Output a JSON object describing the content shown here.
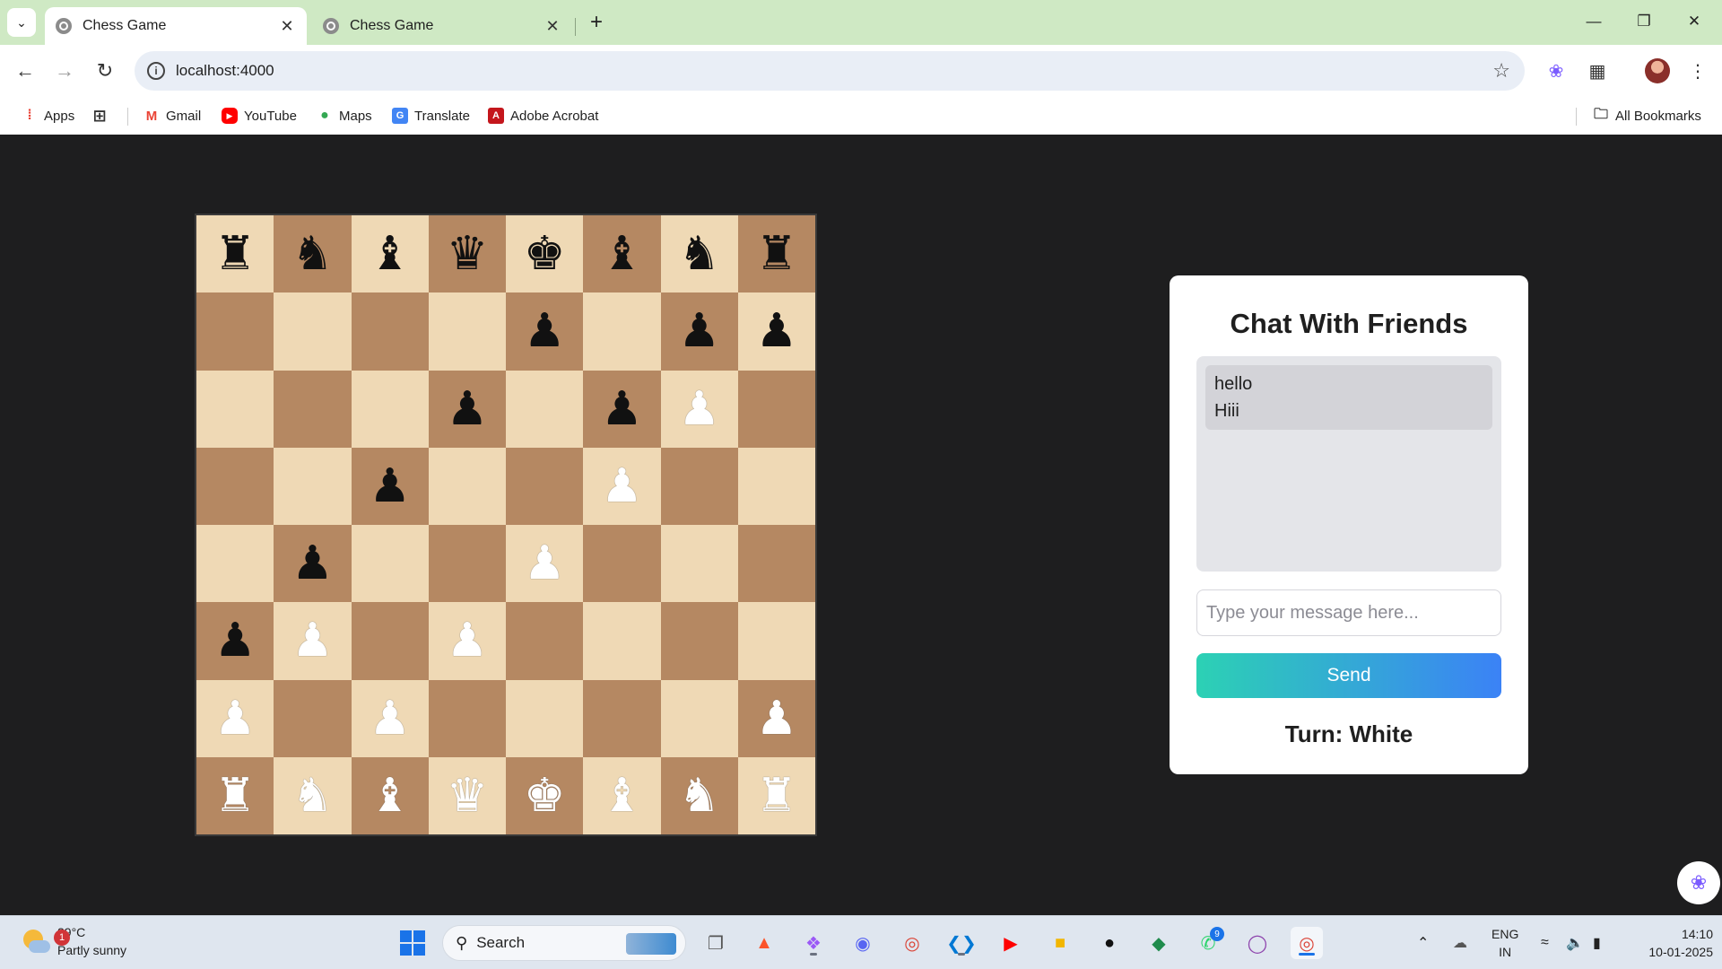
{
  "browser": {
    "tabs": [
      {
        "title": "Chess Game",
        "active": true
      },
      {
        "title": "Chess Game",
        "active": false
      }
    ],
    "url": "localhost:4000",
    "bookmarks": [
      {
        "label": "Apps",
        "icon": "apps-grid-icon"
      },
      {
        "label": "Gmail",
        "icon": "gmail-icon"
      },
      {
        "label": "YouTube",
        "icon": "youtube-icon"
      },
      {
        "label": "Maps",
        "icon": "maps-icon"
      },
      {
        "label": "Translate",
        "icon": "translate-icon"
      },
      {
        "label": "Adobe Acrobat",
        "icon": "acrobat-icon"
      }
    ],
    "all_bookmarks_label": "All Bookmarks"
  },
  "board": {
    "light_color": "#efd9b5",
    "dark_color": "#b58862",
    "rows": [
      [
        "bR",
        "bN",
        "bB",
        "bQ",
        "bK",
        "bB",
        "bN",
        "bR"
      ],
      [
        "",
        "",
        "",
        "",
        "bP",
        "",
        "bP",
        "bP"
      ],
      [
        "",
        "",
        "",
        "bP",
        "",
        "bP",
        "wP",
        ""
      ],
      [
        "",
        "",
        "bP",
        "",
        "",
        "wP",
        "",
        ""
      ],
      [
        "",
        "bP",
        "",
        "",
        "wP",
        "",
        "",
        ""
      ],
      [
        "bP",
        "wP",
        "",
        "wP",
        "",
        "",
        "",
        ""
      ],
      [
        "wP",
        "",
        "wP",
        "",
        "",
        "",
        "",
        "wP"
      ],
      [
        "wR",
        "wN",
        "wB",
        "wQ",
        "wK",
        "wB",
        "wN",
        "wR"
      ]
    ]
  },
  "chat": {
    "title": "Chat With Friends",
    "messages": [
      "hello",
      "Hiii"
    ],
    "input_placeholder": "Type your message here...",
    "input_value": "",
    "send_label": "Send",
    "turn_text": "Turn: White",
    "send_gradient": [
      "#2cd1b4",
      "#3b82f6"
    ]
  },
  "taskbar": {
    "weather_temp": "29°C",
    "weather_desc": "Partly sunny",
    "weather_badge": "1",
    "search_label": "Search",
    "whatsapp_badge": "9",
    "lang_line1": "ENG",
    "lang_line2": "IN",
    "time": "14:10",
    "date": "10-01-2025"
  }
}
